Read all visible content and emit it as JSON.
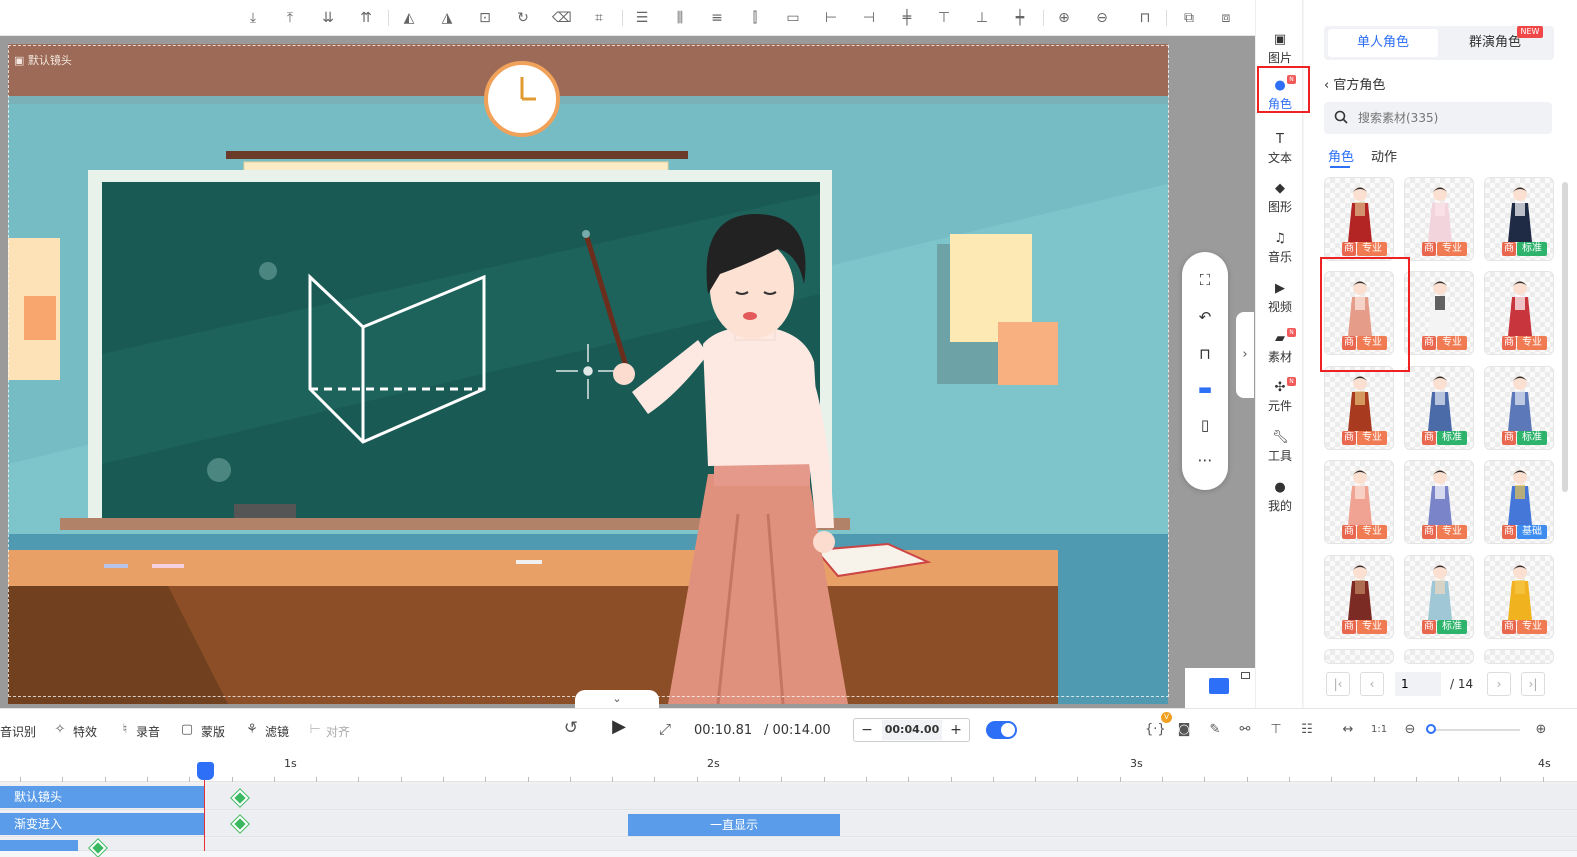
{
  "canvas": {
    "camera_label": "默认镜头"
  },
  "toolbar": {
    "icons": [
      "move-down-icon",
      "move-up-icon",
      "to-bottom-icon",
      "to-top-icon",
      "flip-h-icon",
      "flip-v-icon",
      "lock-icon",
      "rotate-icon",
      "delete-icon",
      "crop-icon",
      "align-top-icon",
      "align-middle-icon",
      "align-bottom-icon",
      "distribute-h-icon",
      "distribute-v-icon",
      "align-left-icon",
      "align-right-icon",
      "align-center-icon",
      "align-top-edge-icon",
      "align-bottom-edge-icon",
      "align-vcenter-icon",
      "zoom-in-icon",
      "zoom-out-icon",
      "unlock-icon",
      "copy-icon",
      "paste-icon"
    ]
  },
  "nav": {
    "items": [
      {
        "label": "图片",
        "icon": "image-icon"
      },
      {
        "label": "角色",
        "icon": "person-icon",
        "active": true,
        "badge": "N"
      },
      {
        "label": "文本",
        "icon": "text-icon"
      },
      {
        "label": "图形",
        "icon": "shape-icon"
      },
      {
        "label": "音乐",
        "icon": "music-icon"
      },
      {
        "label": "视频",
        "icon": "video-icon"
      },
      {
        "label": "素材",
        "icon": "folder-icon",
        "badge": "N"
      },
      {
        "label": "元件",
        "icon": "pinwheel-icon",
        "badge": "N"
      },
      {
        "label": "工具",
        "icon": "wrench-icon"
      },
      {
        "label": "我的",
        "icon": "user-icon"
      }
    ]
  },
  "panel": {
    "tab_single": "单人角色",
    "tab_group": "群演角色",
    "new_badge": "NEW",
    "back": "官方角色",
    "search_placeholder": "搜索素材(335)",
    "subtab_role": "角色",
    "subtab_action": "动作",
    "badge_shang": "商",
    "cards": [
      {
        "tag": "专业"
      },
      {
        "tag": "专业"
      },
      {
        "tag": "标准"
      },
      {
        "tag": "专业"
      },
      {
        "tag": "专业"
      },
      {
        "tag": "专业"
      },
      {
        "tag": "专业"
      },
      {
        "tag": "标准"
      },
      {
        "tag": "标准"
      },
      {
        "tag": "专业"
      },
      {
        "tag": "专业"
      },
      {
        "tag": "基础"
      },
      {
        "tag": "专业"
      },
      {
        "tag": "标准"
      },
      {
        "tag": "专业"
      }
    ],
    "page_current": "1",
    "page_total": "/ 14"
  },
  "controls": {
    "speech": "音识别",
    "effects": "特效",
    "record": "录音",
    "mask": "蒙版",
    "filter": "滤镜",
    "align": "对齐",
    "time_current": "00:10.81",
    "time_total": "/ 00:14.00",
    "duration": "00:04.00",
    "vip_badge": "V",
    "toggle_on": true
  },
  "timeline": {
    "ticks": [
      "1s",
      "2s",
      "3s",
      "4s"
    ],
    "tracks": [
      {
        "label": "默认镜头"
      },
      {
        "label": "渐变进入",
        "clip": "一直显示"
      }
    ]
  },
  "colors": {
    "accent": "#2d6ff7",
    "highlight": "#e22222",
    "track": "#5a9ce9",
    "keyframe": "#3cb862"
  }
}
